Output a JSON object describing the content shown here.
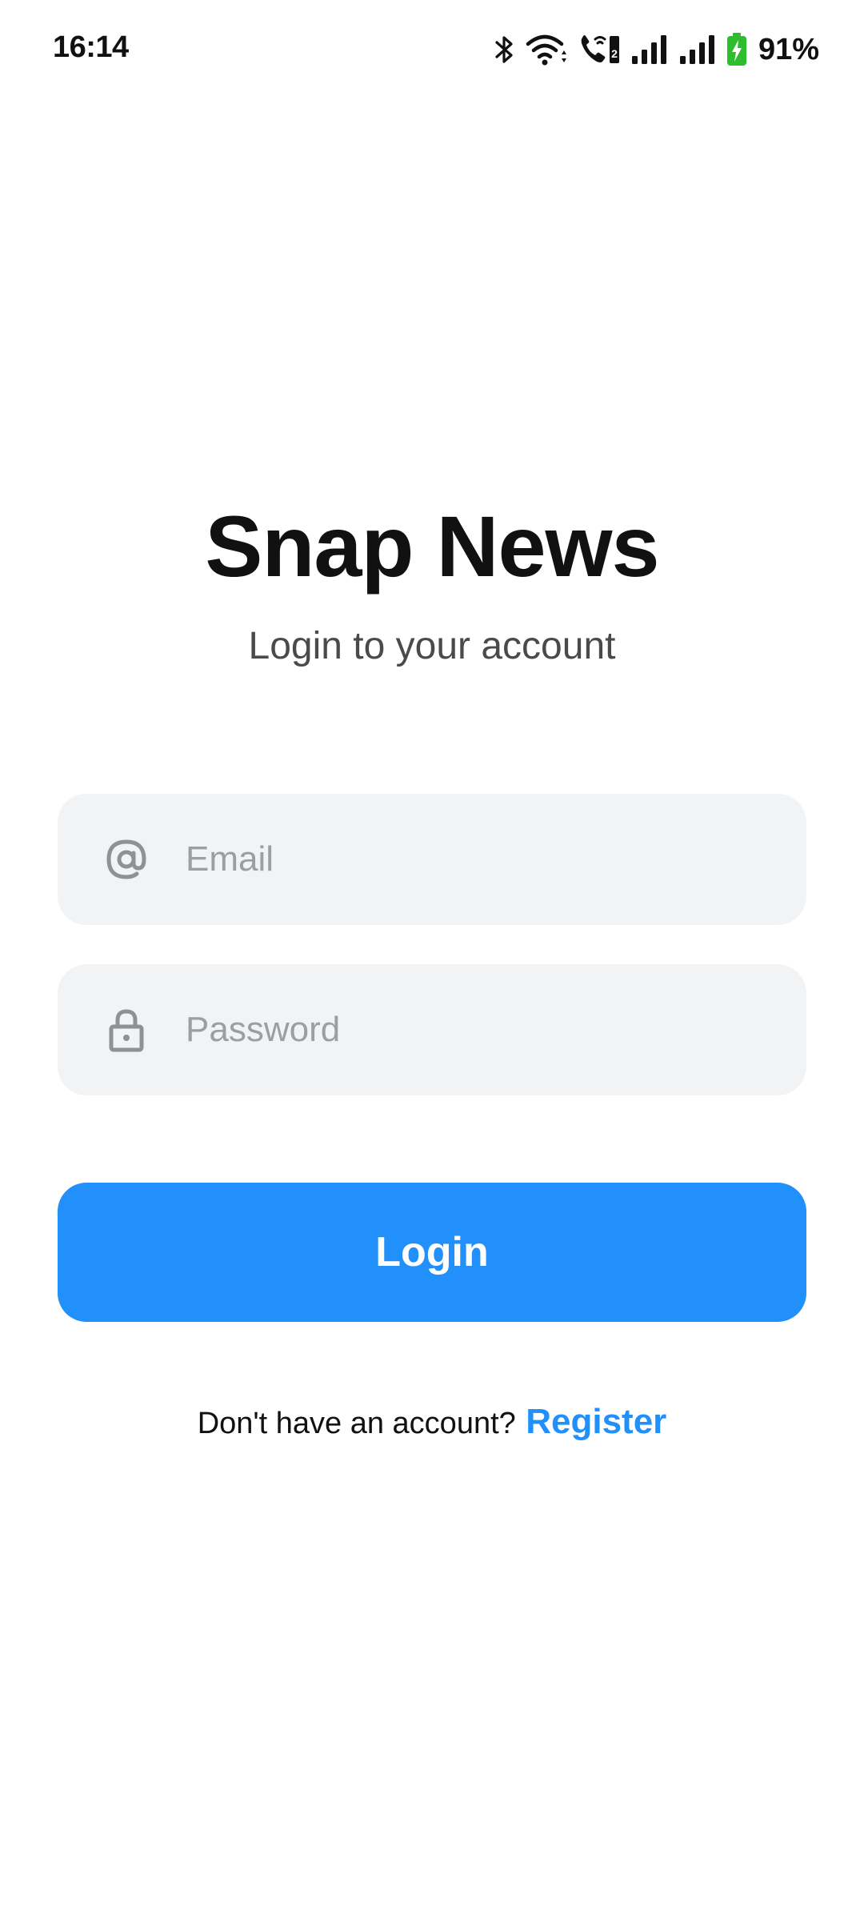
{
  "status_bar": {
    "time": "16:14",
    "battery_percent": "91%",
    "icons": [
      "bluetooth-icon",
      "wifi-icon",
      "wifi-calling-icon",
      "signal-1-icon",
      "signal-2-icon",
      "battery-charging-icon"
    ],
    "battery_color": "#2dbe2d"
  },
  "header": {
    "title": "Snap News",
    "subtitle": "Login to your account"
  },
  "form": {
    "email": {
      "placeholder": "Email",
      "value": "",
      "icon": "at-sign-icon"
    },
    "password": {
      "placeholder": "Password",
      "value": "",
      "icon": "lock-icon"
    },
    "login_label": "Login"
  },
  "footer": {
    "prompt": "Don't have an account?",
    "register_label": "Register"
  },
  "colors": {
    "accent": "#2190fb",
    "field_bg": "#f2f3f5",
    "placeholder": "#9b9ea3",
    "title": "#111111"
  }
}
